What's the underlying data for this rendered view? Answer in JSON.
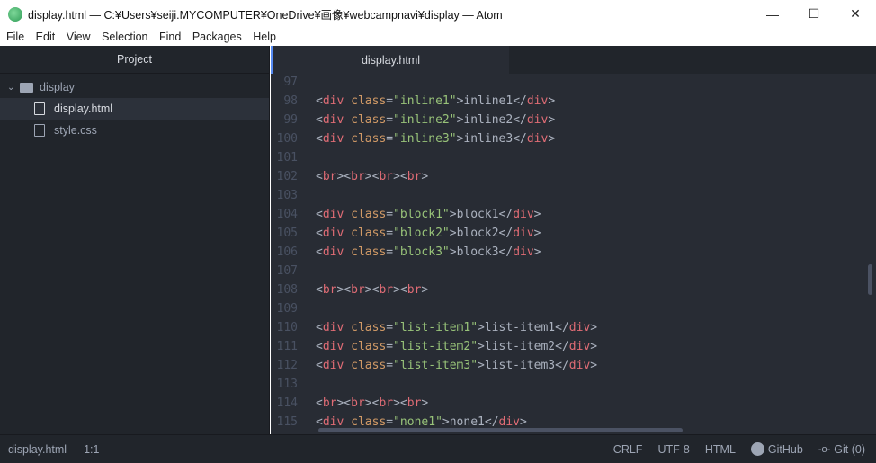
{
  "window": {
    "title": "display.html — C:¥Users¥seiji.MYCOMPUTER¥OneDrive¥画像¥webcampnavi¥display — Atom",
    "minimize": "—",
    "maximize": "☐",
    "close": "✕"
  },
  "menu": [
    "File",
    "Edit",
    "View",
    "Selection",
    "Find",
    "Packages",
    "Help"
  ],
  "sidebar": {
    "title": "Project",
    "folder": "display",
    "files": [
      "display.html",
      "style.css"
    ],
    "selected": "display.html"
  },
  "tab": {
    "label": "display.html"
  },
  "colors": {
    "tag": "#e06c75",
    "attr": "#d19a66",
    "string": "#98c379",
    "text": "#abb2bf",
    "accent": "#568af2"
  },
  "code": [
    {
      "n": "97",
      "tokens": []
    },
    {
      "n": "98",
      "tokens": [
        [
          "p",
          "<"
        ],
        [
          "tag",
          "div"
        ],
        [
          "p",
          " "
        ],
        [
          "attr",
          "class"
        ],
        [
          "p",
          "="
        ],
        [
          "str",
          "\"inline1\""
        ],
        [
          "p",
          ">"
        ],
        [
          "txt",
          "inline1"
        ],
        [
          "p",
          "</"
        ],
        [
          "tag",
          "div"
        ],
        [
          "p",
          ">"
        ]
      ]
    },
    {
      "n": "99",
      "tokens": [
        [
          "p",
          "<"
        ],
        [
          "tag",
          "div"
        ],
        [
          "p",
          " "
        ],
        [
          "attr",
          "class"
        ],
        [
          "p",
          "="
        ],
        [
          "str",
          "\"inline2\""
        ],
        [
          "p",
          ">"
        ],
        [
          "txt",
          "inline2"
        ],
        [
          "p",
          "</"
        ],
        [
          "tag",
          "div"
        ],
        [
          "p",
          ">"
        ]
      ]
    },
    {
      "n": "100",
      "tokens": [
        [
          "p",
          "<"
        ],
        [
          "tag",
          "div"
        ],
        [
          "p",
          " "
        ],
        [
          "attr",
          "class"
        ],
        [
          "p",
          "="
        ],
        [
          "str",
          "\"inline3\""
        ],
        [
          "p",
          ">"
        ],
        [
          "txt",
          "inline3"
        ],
        [
          "p",
          "</"
        ],
        [
          "tag",
          "div"
        ],
        [
          "p",
          ">"
        ]
      ]
    },
    {
      "n": "101",
      "tokens": []
    },
    {
      "n": "102",
      "tokens": [
        [
          "p",
          "<"
        ],
        [
          "tag",
          "br"
        ],
        [
          "p",
          "><"
        ],
        [
          "tag",
          "br"
        ],
        [
          "p",
          "><"
        ],
        [
          "tag",
          "br"
        ],
        [
          "p",
          "><"
        ],
        [
          "tag",
          "br"
        ],
        [
          "p",
          ">"
        ]
      ]
    },
    {
      "n": "103",
      "tokens": []
    },
    {
      "n": "104",
      "tokens": [
        [
          "p",
          "<"
        ],
        [
          "tag",
          "div"
        ],
        [
          "p",
          " "
        ],
        [
          "attr",
          "class"
        ],
        [
          "p",
          "="
        ],
        [
          "str",
          "\"block1\""
        ],
        [
          "p",
          ">"
        ],
        [
          "txt",
          "block1"
        ],
        [
          "p",
          "</"
        ],
        [
          "tag",
          "div"
        ],
        [
          "p",
          ">"
        ]
      ]
    },
    {
      "n": "105",
      "tokens": [
        [
          "p",
          "<"
        ],
        [
          "tag",
          "div"
        ],
        [
          "p",
          " "
        ],
        [
          "attr",
          "class"
        ],
        [
          "p",
          "="
        ],
        [
          "str",
          "\"block2\""
        ],
        [
          "p",
          ">"
        ],
        [
          "txt",
          "block2"
        ],
        [
          "p",
          "</"
        ],
        [
          "tag",
          "div"
        ],
        [
          "p",
          ">"
        ]
      ]
    },
    {
      "n": "106",
      "tokens": [
        [
          "p",
          "<"
        ],
        [
          "tag",
          "div"
        ],
        [
          "p",
          " "
        ],
        [
          "attr",
          "class"
        ],
        [
          "p",
          "="
        ],
        [
          "str",
          "\"block3\""
        ],
        [
          "p",
          ">"
        ],
        [
          "txt",
          "block3"
        ],
        [
          "p",
          "</"
        ],
        [
          "tag",
          "div"
        ],
        [
          "p",
          ">"
        ]
      ]
    },
    {
      "n": "107",
      "tokens": []
    },
    {
      "n": "108",
      "tokens": [
        [
          "p",
          "<"
        ],
        [
          "tag",
          "br"
        ],
        [
          "p",
          "><"
        ],
        [
          "tag",
          "br"
        ],
        [
          "p",
          "><"
        ],
        [
          "tag",
          "br"
        ],
        [
          "p",
          "><"
        ],
        [
          "tag",
          "br"
        ],
        [
          "p",
          ">"
        ]
      ]
    },
    {
      "n": "109",
      "tokens": []
    },
    {
      "n": "110",
      "tokens": [
        [
          "p",
          "<"
        ],
        [
          "tag",
          "div"
        ],
        [
          "p",
          " "
        ],
        [
          "attr",
          "class"
        ],
        [
          "p",
          "="
        ],
        [
          "str",
          "\"list-item1\""
        ],
        [
          "p",
          ">"
        ],
        [
          "txt",
          "list-item1"
        ],
        [
          "p",
          "</"
        ],
        [
          "tag",
          "div"
        ],
        [
          "p",
          ">"
        ]
      ]
    },
    {
      "n": "111",
      "tokens": [
        [
          "p",
          "<"
        ],
        [
          "tag",
          "div"
        ],
        [
          "p",
          " "
        ],
        [
          "attr",
          "class"
        ],
        [
          "p",
          "="
        ],
        [
          "str",
          "\"list-item2\""
        ],
        [
          "p",
          ">"
        ],
        [
          "txt",
          "list-item2"
        ],
        [
          "p",
          "</"
        ],
        [
          "tag",
          "div"
        ],
        [
          "p",
          ">"
        ]
      ]
    },
    {
      "n": "112",
      "tokens": [
        [
          "p",
          "<"
        ],
        [
          "tag",
          "div"
        ],
        [
          "p",
          " "
        ],
        [
          "attr",
          "class"
        ],
        [
          "p",
          "="
        ],
        [
          "str",
          "\"list-item3\""
        ],
        [
          "p",
          ">"
        ],
        [
          "txt",
          "list-item3"
        ],
        [
          "p",
          "</"
        ],
        [
          "tag",
          "div"
        ],
        [
          "p",
          ">"
        ]
      ]
    },
    {
      "n": "113",
      "tokens": []
    },
    {
      "n": "114",
      "tokens": [
        [
          "p",
          "<"
        ],
        [
          "tag",
          "br"
        ],
        [
          "p",
          "><"
        ],
        [
          "tag",
          "br"
        ],
        [
          "p",
          "><"
        ],
        [
          "tag",
          "br"
        ],
        [
          "p",
          "><"
        ],
        [
          "tag",
          "br"
        ],
        [
          "p",
          ">"
        ]
      ]
    },
    {
      "n": "115",
      "tokens": [
        [
          "p",
          "<"
        ],
        [
          "tag",
          "div"
        ],
        [
          "p",
          " "
        ],
        [
          "attr",
          "class"
        ],
        [
          "p",
          "="
        ],
        [
          "str",
          "\"none1\""
        ],
        [
          "p",
          ">"
        ],
        [
          "txt",
          "none1"
        ],
        [
          "p",
          "</"
        ],
        [
          "tag",
          "div"
        ],
        [
          "p",
          ">"
        ]
      ]
    }
  ],
  "status": {
    "file": "display.html",
    "cursor": "1:1",
    "line_ending": "CRLF",
    "encoding": "UTF-8",
    "grammar": "HTML",
    "github": "GitHub",
    "git": "Git (0)"
  }
}
